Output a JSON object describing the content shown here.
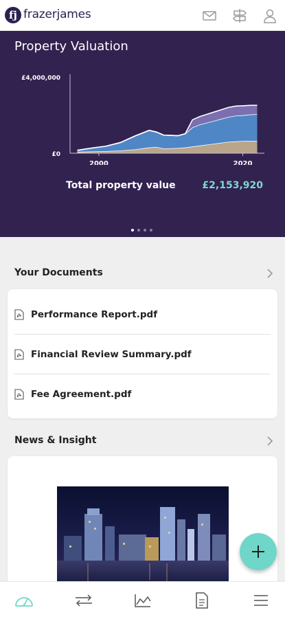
{
  "header": {
    "logo_mark": "fj",
    "brand": "frazerjames",
    "icons": [
      "mail-icon",
      "signpost-icon",
      "user-icon"
    ]
  },
  "valuation": {
    "title": "Property Valuation",
    "total_label": "Total property value",
    "total_value": "£2,153,920",
    "carousel": {
      "count": 4,
      "active": 1
    }
  },
  "chart_data": {
    "type": "area",
    "title": "",
    "xlabel": "",
    "ylabel": "",
    "y_tick_labels": [
      "£4,000,000",
      "£0"
    ],
    "x_tick_labels": [
      "2000",
      "2020"
    ],
    "ylim": [
      0,
      4000000
    ],
    "xlim": [
      1996,
      2023
    ],
    "x": [
      1997,
      1999,
      2001,
      2003,
      2005,
      2007,
      2008,
      2009,
      2011,
      2012,
      2013,
      2014,
      2015,
      2016,
      2017,
      2018,
      2019,
      2020,
      2021,
      2022
    ],
    "series": [
      {
        "color": "#b8a58c",
        "values": [
          70000,
          90000,
          110000,
          140000,
          200000,
          300000,
          330000,
          250000,
          270000,
          300000,
          350000,
          400000,
          450000,
          500000,
          550000,
          600000,
          620000,
          640000,
          650000,
          650000
        ]
      },
      {
        "color": "#4f86c6",
        "values": [
          80000,
          180000,
          260000,
          420000,
          700000,
          900000,
          780000,
          700000,
          650000,
          720000,
          1000000,
          1100000,
          1150000,
          1200000,
          1250000,
          1300000,
          1350000,
          1350000,
          1380000,
          1400000
        ]
      },
      {
        "color": "#7b6fb0",
        "values": [
          0,
          0,
          0,
          0,
          0,
          0,
          0,
          0,
          0,
          0,
          400000,
          420000,
          440000,
          460000,
          480000,
          500000,
          500000,
          500000,
          480000,
          460000
        ]
      }
    ],
    "grid": false
  },
  "documents": {
    "title": "Your Documents",
    "items": [
      {
        "label": "Performance Report.pdf"
      },
      {
        "label": "Financial Review Summary.pdf"
      },
      {
        "label": "Fee Agreement.pdf"
      }
    ]
  },
  "news": {
    "title": "News & Insight"
  },
  "fab": {
    "symbol": "+"
  },
  "bottom_nav": {
    "items": [
      "dashboard-icon",
      "transfer-icon",
      "chart-icon",
      "document-icon",
      "menu-icon"
    ],
    "active": 0,
    "active_color": "#6fd6c9"
  }
}
